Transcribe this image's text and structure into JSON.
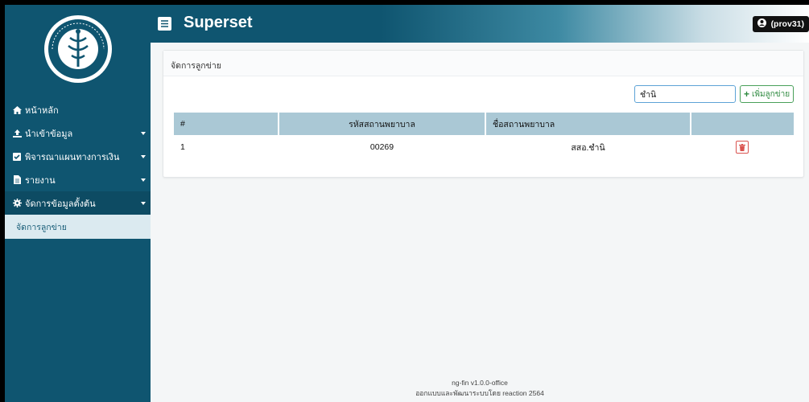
{
  "app": {
    "title": "Superset"
  },
  "user": {
    "label": "(prov31)"
  },
  "sidebar": {
    "items": [
      {
        "label": "หน้าหลัก",
        "icon": "home-icon",
        "has_caret": false
      },
      {
        "label": "นำเข้าข้อมูล",
        "icon": "upload-icon",
        "has_caret": true
      },
      {
        "label": "พิจารณาแผนทางการเงิน",
        "icon": "check-square-icon",
        "has_caret": true
      },
      {
        "label": "รายงาน",
        "icon": "file-icon",
        "has_caret": true
      },
      {
        "label": "จัดการข้อมูลตั้งต้น",
        "icon": "gear-icon",
        "has_caret": true
      }
    ],
    "submenu": {
      "label": "จัดการลูกข่าย"
    }
  },
  "card": {
    "title": "จัดการลูกข่าย"
  },
  "search": {
    "value": "ชำนิ"
  },
  "add_button": {
    "label": "เพิ่มลูกข่าย"
  },
  "table": {
    "headers": [
      "#",
      "รหัสสถานพยาบาล",
      "ชื่อสถานพยาบาล",
      ""
    ],
    "rows": [
      {
        "no": "1",
        "code": "00269",
        "name": "สสอ.ชำนิ"
      }
    ]
  },
  "footer": {
    "line1": "ng-fin v1.0.0-office",
    "line2": "ออกแบบและพัฒนาระบบโดย reaction 2564"
  },
  "colors": {
    "sidebar": "#0f5570",
    "table_header": "#aac8d5",
    "add_button": "#49a05a",
    "delete_button": "#d9534f"
  }
}
